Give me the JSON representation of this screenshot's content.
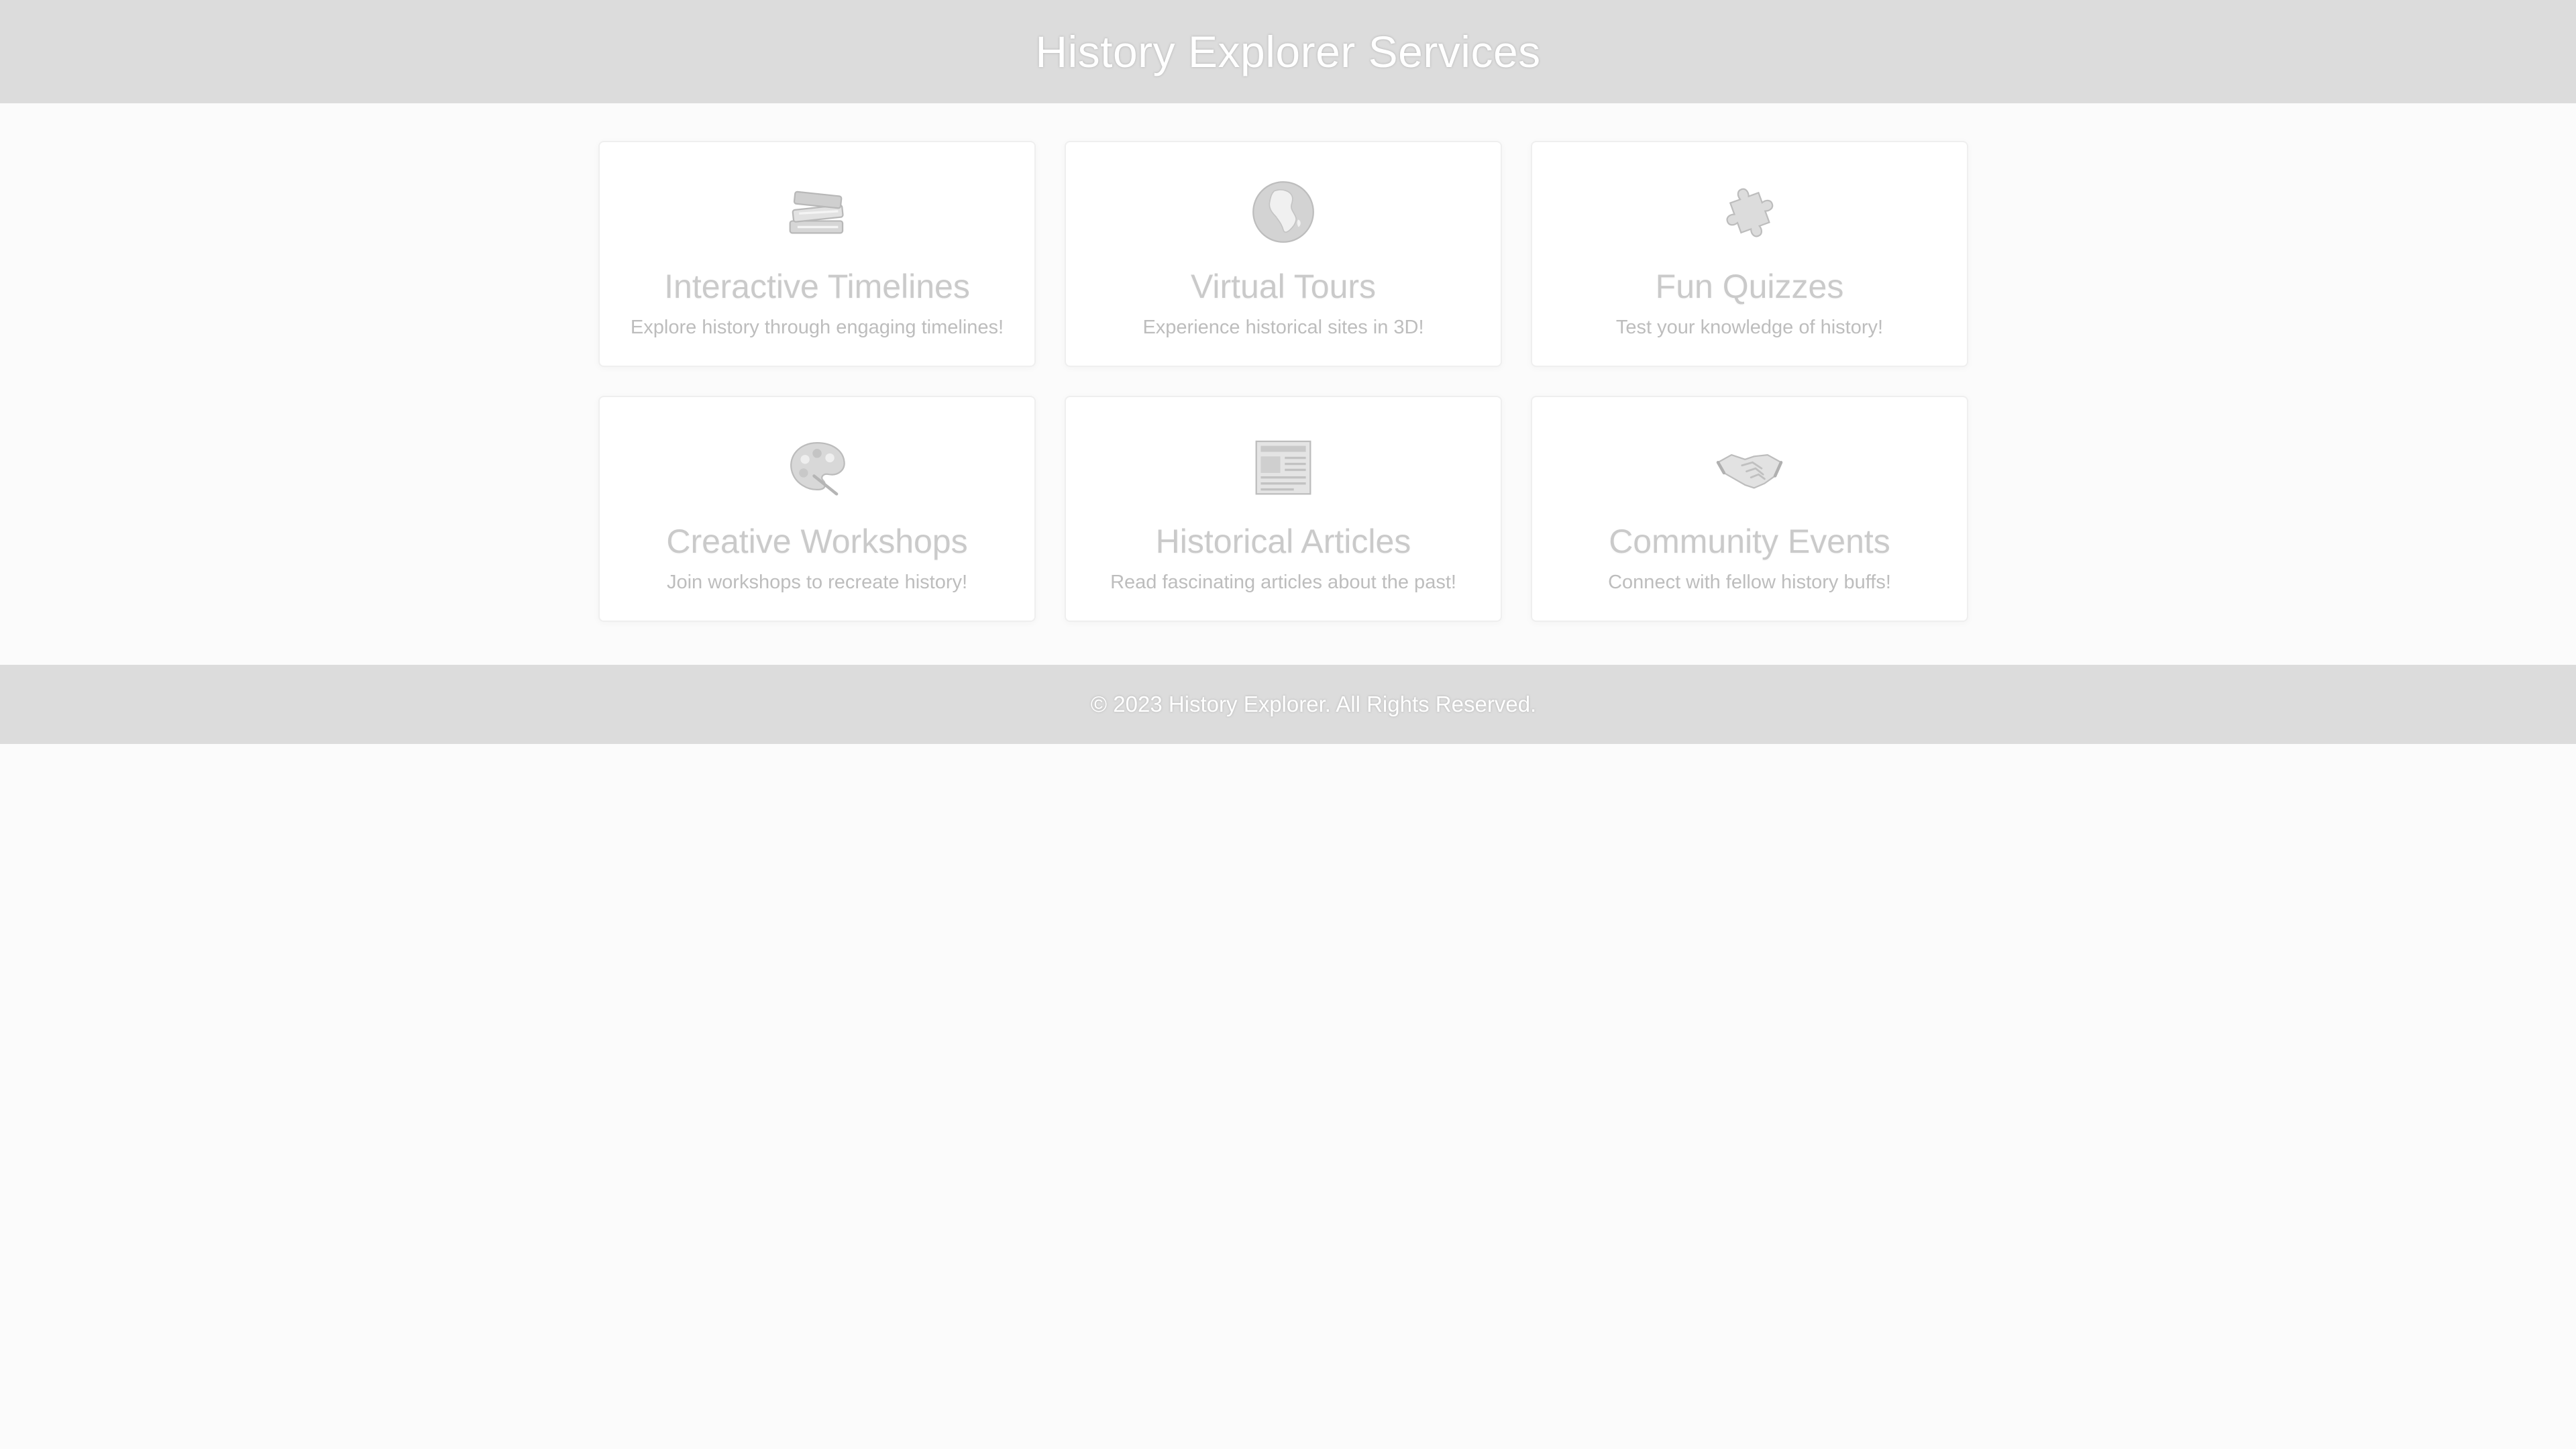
{
  "header": {
    "title": "History Explorer Services"
  },
  "services": [
    {
      "icon": "books-icon",
      "title": "Interactive Timelines",
      "description": "Explore history through engaging timelines!"
    },
    {
      "icon": "globe-africa-icon",
      "title": "Virtual Tours",
      "description": "Experience historical sites in 3D!"
    },
    {
      "icon": "puzzle-piece-icon",
      "title": "Fun Quizzes",
      "description": "Test your knowledge of history!"
    },
    {
      "icon": "artist-palette-icon",
      "title": "Creative Workshops",
      "description": "Join workshops to recreate history!"
    },
    {
      "icon": "newspaper-icon",
      "title": "Historical Articles",
      "description": "Read fascinating articles about the past!"
    },
    {
      "icon": "handshake-icon",
      "title": "Community Events",
      "description": "Connect with fellow history buffs!"
    }
  ],
  "footer": {
    "text": "© 2023 History Explorer. All Rights Reserved."
  }
}
